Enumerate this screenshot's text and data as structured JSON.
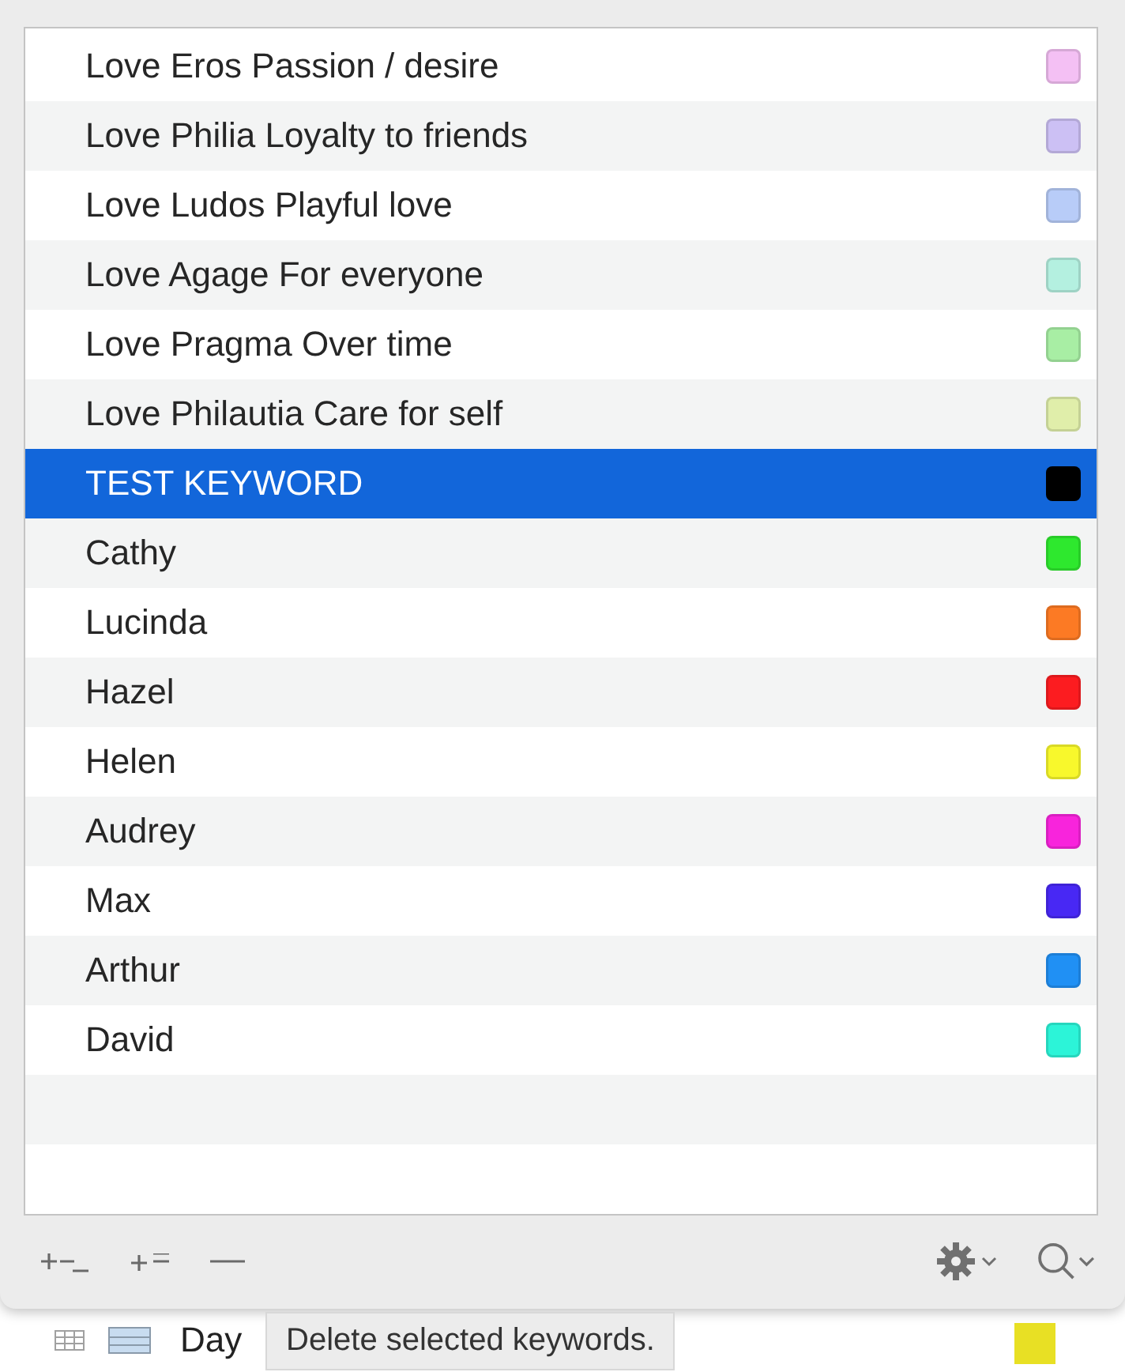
{
  "keywords": [
    {
      "label": "Love Eros Passion / desire",
      "color": "#f4c0f4",
      "selected": false
    },
    {
      "label": "Love Philia Loyalty to friends",
      "color": "#ccc0f4",
      "selected": false
    },
    {
      "label": "Love Ludos Playful love",
      "color": "#b8ccf8",
      "selected": false
    },
    {
      "label": "Love Agage For everyone",
      "color": "#b4f0e0",
      "selected": false
    },
    {
      "label": "Love Pragma Over time",
      "color": "#a8eea4",
      "selected": false
    },
    {
      "label": "Love Philautia Care for self",
      "color": "#e0eeaa",
      "selected": false
    },
    {
      "label": "TEST KEYWORD",
      "color": "#000000",
      "selected": true
    },
    {
      "label": "Cathy",
      "color": "#2ee82e",
      "selected": false
    },
    {
      "label": "Lucinda",
      "color": "#fc7a24",
      "selected": false
    },
    {
      "label": "Hazel",
      "color": "#fc1c20",
      "selected": false
    },
    {
      "label": "Helen",
      "color": "#f8f82c",
      "selected": false
    },
    {
      "label": "Audrey",
      "color": "#f824dc",
      "selected": false
    },
    {
      "label": "Max",
      "color": "#4828f4",
      "selected": false
    },
    {
      "label": "Arthur",
      "color": "#2090f4",
      "selected": false
    },
    {
      "label": "David",
      "color": "#2cf4d8",
      "selected": false
    }
  ],
  "background_row": {
    "title": "Day",
    "color": "#e8e024"
  },
  "tooltip": "Delete selected keywords."
}
